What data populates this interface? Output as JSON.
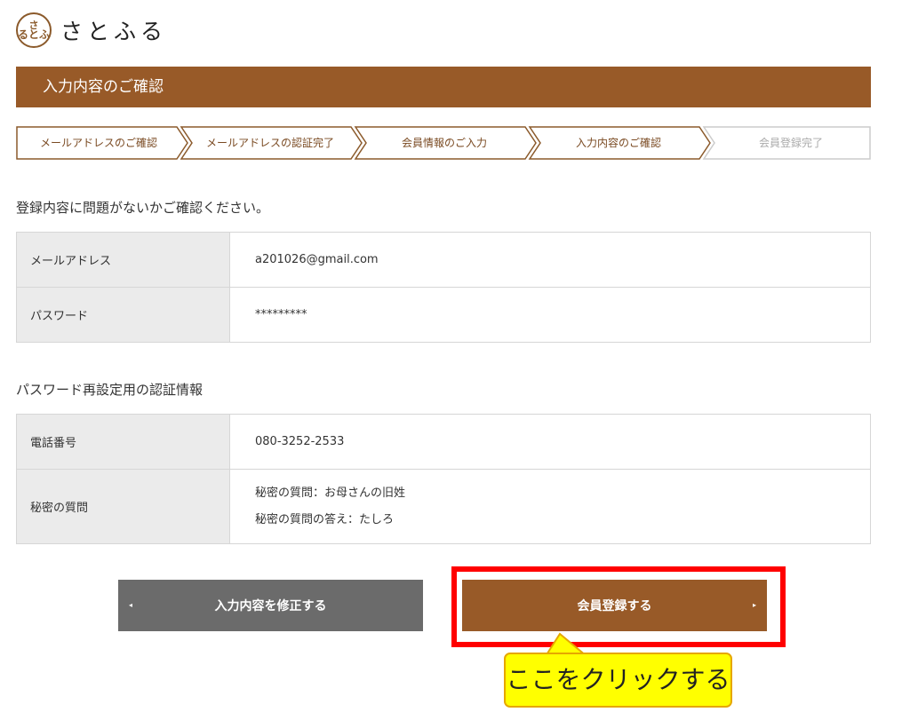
{
  "logo": {
    "mark_line1": "さ",
    "mark_line2": "るとふ",
    "text": "さとふる"
  },
  "page_title": "入力内容のご確認",
  "steps": [
    {
      "label": "メールアドレスのご確認",
      "state": "done"
    },
    {
      "label": "メールアドレスの認証完了",
      "state": "done"
    },
    {
      "label": "会員情報のご入力",
      "state": "done"
    },
    {
      "label": "入力内容のご確認",
      "state": "current"
    },
    {
      "label": "会員登録完了",
      "state": "pending"
    }
  ],
  "intro_text": "登録内容に問題がないかご確認ください。",
  "account": {
    "email_label": "メールアドレス",
    "email_value": "a201026@gmail.com",
    "password_label": "パスワード",
    "password_value": "*********"
  },
  "recovery": {
    "heading": "パスワード再設定用の認証情報",
    "phone_label": "電話番号",
    "phone_value": "080-3252-2533",
    "secret_label": "秘密の質問",
    "secret_question": "秘密の質問：お母さんの旧姓",
    "secret_answer": "秘密の質問の答え：たしろ"
  },
  "buttons": {
    "back_label": "入力内容を修正する",
    "back_arrow": "◂",
    "submit_label": "会員登録する",
    "submit_arrow": "▸"
  },
  "annotation": {
    "callout_text": "ここをクリックする"
  },
  "colors": {
    "brand": "#985a28",
    "back_button": "#6b6b6b",
    "highlight": "#ff0000",
    "callout_fill": "#ffff00",
    "callout_border": "#e6a700"
  }
}
